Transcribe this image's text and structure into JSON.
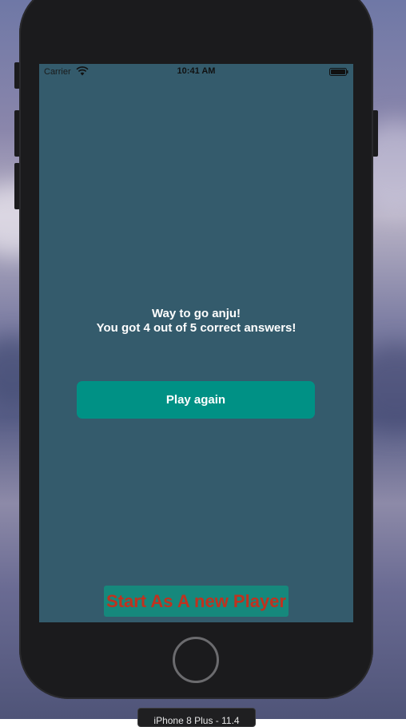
{
  "status_bar": {
    "carrier": "Carrier",
    "time": "10:41 AM",
    "wifi_icon": "wifi-icon",
    "battery_icon": "battery-icon"
  },
  "result": {
    "line1": "Way to go anju!",
    "line2": "You got 4 out of 5 correct answers!"
  },
  "buttons": {
    "play_again": "Play again",
    "new_player": "Start As A new Player"
  },
  "device_label": "iPhone 8 Plus - 11.4",
  "colors": {
    "screen_background": "#345b6c",
    "play_again_background": "#009185",
    "new_player_background": "#16887c",
    "new_player_text": "#c0321f"
  }
}
